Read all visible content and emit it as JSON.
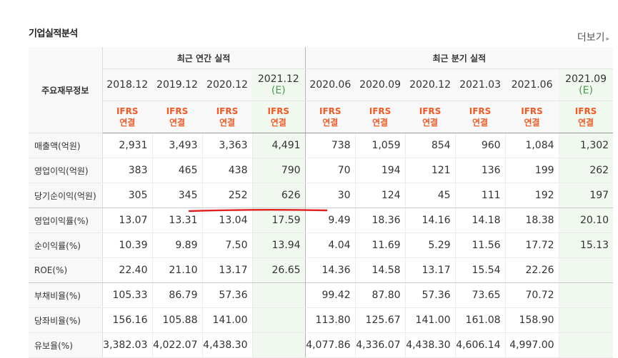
{
  "page": {
    "title": "기업실적분석",
    "more_label": "더보기",
    "more_arrow": "▸"
  },
  "header": {
    "row_label": "주요재무정보",
    "annual_group": "최근 연간 실적",
    "quarter_group": "최근 분기 실적",
    "periods": [
      {
        "line1": "2018.12",
        "line2": "",
        "estimate": false,
        "annual": true
      },
      {
        "line1": "2019.12",
        "line2": "",
        "estimate": false,
        "annual": true
      },
      {
        "line1": "2020.12",
        "line2": "",
        "estimate": false,
        "annual": true
      },
      {
        "line1": "2021.12",
        "line2": "(E)",
        "estimate": true,
        "annual": true
      },
      {
        "line1": "2020.06",
        "line2": "",
        "estimate": false,
        "annual": false
      },
      {
        "line1": "2020.09",
        "line2": "",
        "estimate": false,
        "annual": false
      },
      {
        "line1": "2020.12",
        "line2": "",
        "estimate": false,
        "annual": false
      },
      {
        "line1": "2021.03",
        "line2": "",
        "estimate": false,
        "annual": false
      },
      {
        "line1": "2021.06",
        "line2": "",
        "estimate": false,
        "annual": false
      },
      {
        "line1": "2021.09",
        "line2": "(E)",
        "estimate": true,
        "annual": false
      }
    ],
    "basis_line1": "IFRS",
    "basis_line2": "연결"
  },
  "rows": [
    {
      "label": "매출액(억원)",
      "values": [
        "2,931",
        "3,493",
        "3,363",
        "4,491",
        "738",
        "1,059",
        "854",
        "960",
        "1,084",
        "1,302"
      ]
    },
    {
      "label": "영업이익(억원)",
      "values": [
        "383",
        "465",
        "438",
        "790",
        "70",
        "194",
        "121",
        "136",
        "199",
        "262"
      ]
    },
    {
      "label": "당기순이익(억원)",
      "values": [
        "305",
        "345",
        "252",
        "626",
        "30",
        "124",
        "45",
        "111",
        "192",
        "197"
      ]
    },
    {
      "label": "영업이익률(%)",
      "values": [
        "13.07",
        "13.31",
        "13.04",
        "17.59",
        "9.49",
        "18.36",
        "14.16",
        "14.18",
        "18.38",
        "20.10"
      ]
    },
    {
      "label": "순이익률(%)",
      "values": [
        "10.39",
        "9.89",
        "7.50",
        "13.94",
        "4.04",
        "11.69",
        "5.29",
        "11.56",
        "17.72",
        "15.13"
      ]
    },
    {
      "label": "ROE(%)",
      "values": [
        "22.40",
        "21.10",
        "13.17",
        "26.65",
        "14.36",
        "14.58",
        "13.17",
        "15.54",
        "22.26",
        ""
      ]
    },
    {
      "label": "부채비율(%)",
      "values": [
        "105.33",
        "86.79",
        "57.36",
        "",
        "99.42",
        "87.80",
        "57.36",
        "73.65",
        "70.72",
        ""
      ]
    },
    {
      "label": "당좌비율(%)",
      "values": [
        "156.16",
        "105.88",
        "141.00",
        "",
        "113.80",
        "125.67",
        "141.00",
        "161.08",
        "158.90",
        ""
      ]
    },
    {
      "label": "유보율(%)",
      "values": [
        "3,382.03",
        "4,022.07",
        "4,438.30",
        "",
        "4,077.86",
        "4,336.07",
        "4,438.30",
        "4,606.14",
        "4,997.00",
        ""
      ]
    }
  ],
  "colors": {
    "basis": "#f15a24",
    "estimate_bg": "#f1f8ef",
    "annotation_line": "#e02020"
  }
}
